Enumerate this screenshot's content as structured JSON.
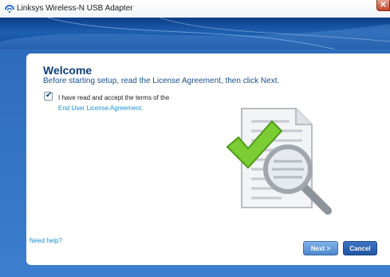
{
  "window": {
    "title": "Linksys Wireless-N USB Adapter",
    "close_glyph": "✕"
  },
  "welcome": {
    "heading": "Welcome",
    "subtitle": "Before starting setup, read the License Agreement, then click Next.",
    "checkbox_checked": true,
    "checkbox_label": "I have read and accept the terms of the",
    "eula_link": "End User License Agreement."
  },
  "footer": {
    "help_link": "Need help?",
    "next_label": "Next >",
    "cancel_label": "Cancel"
  },
  "colors": {
    "banner": "#1e5fb0",
    "link": "#1a8fd0",
    "heading": "#0f3d7a",
    "check_green": "#6ec02a",
    "button_blue": "#2f66b4"
  },
  "icons": [
    "app-icon",
    "checkbox-check-icon",
    "document-icon",
    "green-check-icon",
    "magnifier-icon",
    "close-icon"
  ]
}
